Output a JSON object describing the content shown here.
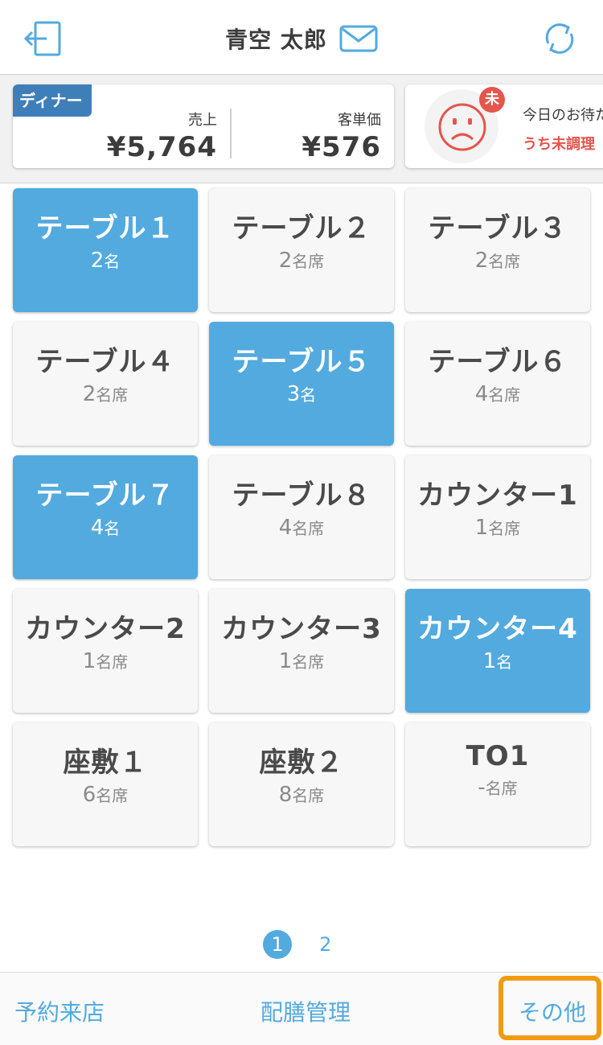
{
  "header": {
    "user_name": "青空 太郎",
    "logout_icon": "logout-icon",
    "mail_icon": "mail-icon",
    "refresh_icon": "refresh-icon"
  },
  "summary": {
    "meal_period": "ディナー",
    "sales_label": "売上",
    "sales_value": "¥5,764",
    "per_customer_label": "客単価",
    "per_customer_value": "¥576",
    "waiting_badge": "未",
    "waiting_title": "今日のお待た",
    "waiting_sub": "うち未調理",
    "face_icon": "sad-face-icon",
    "accent_color": "#e4554b"
  },
  "tables": [
    {
      "name": "テーブル１",
      "count": "2",
      "unit": "名",
      "active": true
    },
    {
      "name": "テーブル２",
      "count": "2",
      "unit": "名席",
      "active": false
    },
    {
      "name": "テーブル３",
      "count": "2",
      "unit": "名席",
      "active": false
    },
    {
      "name": "テーブル４",
      "count": "2",
      "unit": "名席",
      "active": false
    },
    {
      "name": "テーブル５",
      "count": "3",
      "unit": "名",
      "active": true
    },
    {
      "name": "テーブル６",
      "count": "4",
      "unit": "名席",
      "active": false
    },
    {
      "name": "テーブル７",
      "count": "4",
      "unit": "名",
      "active": true
    },
    {
      "name": "テーブル８",
      "count": "4",
      "unit": "名席",
      "active": false
    },
    {
      "name": "カウンター1",
      "count": "1",
      "unit": "名席",
      "active": false
    },
    {
      "name": "カウンター2",
      "count": "1",
      "unit": "名席",
      "active": false
    },
    {
      "name": "カウンター3",
      "count": "1",
      "unit": "名席",
      "active": false
    },
    {
      "name": "カウンター4",
      "count": "1",
      "unit": "名",
      "active": true
    },
    {
      "name": "座敷１",
      "count": "6",
      "unit": "名席",
      "active": false
    },
    {
      "name": "座敷２",
      "count": "8",
      "unit": "名席",
      "active": false
    },
    {
      "name": "TO1",
      "count": "-",
      "unit": "名席",
      "active": false
    }
  ],
  "pagination": {
    "pages": [
      "1",
      "2"
    ],
    "current": "1"
  },
  "bottom_nav": {
    "reservation": "予約来店",
    "serving": "配膳管理",
    "other": "その他"
  },
  "colors": {
    "active_tile": "#52aadf",
    "highlight_frame": "#f39a12",
    "meal_tag": "#3f7fb9"
  }
}
